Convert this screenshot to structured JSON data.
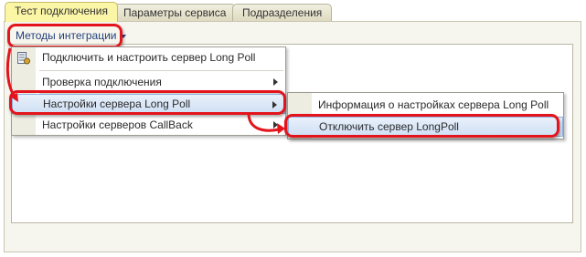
{
  "tabs": [
    {
      "label": "Тест подключения",
      "active": true
    },
    {
      "label": "Параметры сервиса",
      "active": false
    },
    {
      "label": "Подразделения",
      "active": false
    }
  ],
  "methods_button": {
    "label": "Методы интеграции"
  },
  "menu": {
    "items": [
      {
        "label": "Подключить и настроить сервер Long Poll",
        "icon": "server-config-icon"
      },
      {
        "label": "Проверка подключения",
        "has_submenu": true
      },
      {
        "label": "Настройки сервера Long Poll",
        "has_submenu": true,
        "highlighted": true
      },
      {
        "label": "Настройки серверов CallBack",
        "has_submenu": true
      }
    ]
  },
  "submenu": {
    "items": [
      {
        "label": "Информация о настройках сервера Long Poll"
      },
      {
        "label": "Отключить сервер LongPoll",
        "highlighted": true
      }
    ]
  },
  "annotation_color": "#e3141b"
}
